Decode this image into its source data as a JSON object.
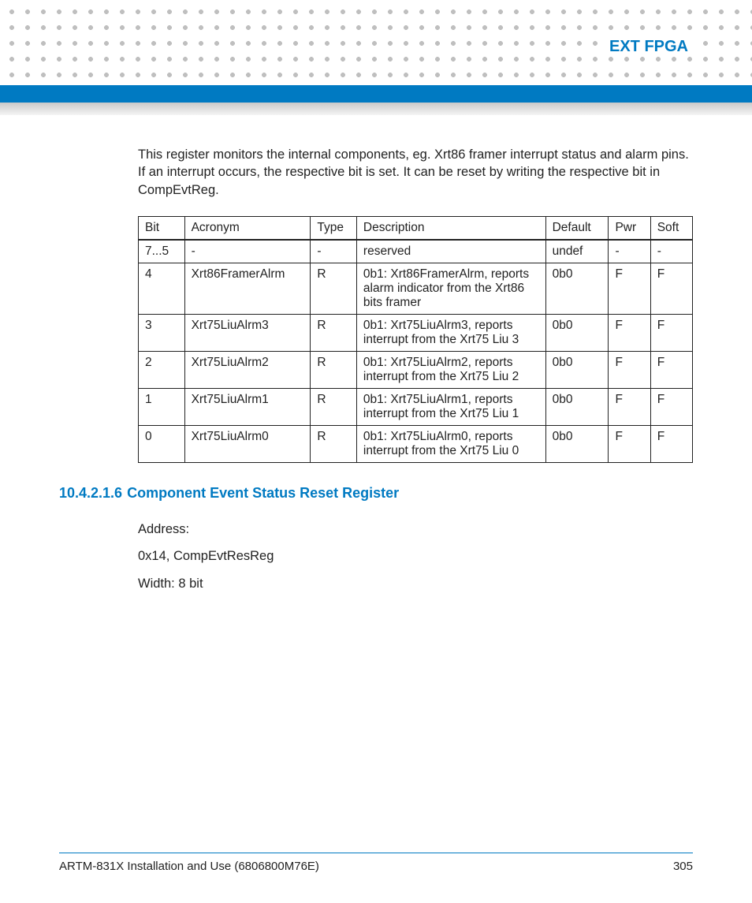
{
  "header": {
    "title": "EXT FPGA"
  },
  "intro": "This register monitors the internal components, eg. Xrt86 framer interrupt status and alarm pins. If an interrupt occurs, the respective bit is set. It can be reset by writing the respective bit in CompEvtReg.",
  "table": {
    "headers": [
      "Bit",
      "Acronym",
      "Type",
      "Description",
      "Default",
      "Pwr",
      "Soft"
    ],
    "rows": [
      {
        "bit": "7...5",
        "acr": "-",
        "type": "-",
        "desc": "reserved",
        "def": "undef",
        "pwr": "-",
        "soft": "-"
      },
      {
        "bit": "4",
        "acr": "Xrt86FramerAlrm",
        "type": "R",
        "desc": "0b1: Xrt86FramerAlrm, reports alarm indicator from the Xrt86 bits framer",
        "def": "0b0",
        "pwr": "F",
        "soft": "F"
      },
      {
        "bit": "3",
        "acr": "Xrt75LiuAlrm3",
        "type": "R",
        "desc": "0b1: Xrt75LiuAlrm3, reports interrupt from the Xrt75 Liu 3",
        "def": "0b0",
        "pwr": "F",
        "soft": "F"
      },
      {
        "bit": "2",
        "acr": "Xrt75LiuAlrm2",
        "type": "R",
        "desc": "0b1: Xrt75LiuAlrm2, reports interrupt from the Xrt75 Liu 2",
        "def": "0b0",
        "pwr": "F",
        "soft": "F"
      },
      {
        "bit": "1",
        "acr": "Xrt75LiuAlrm1",
        "type": "R",
        "desc": "0b1: Xrt75LiuAlrm1, reports interrupt from the Xrt75 Liu 1",
        "def": "0b0",
        "pwr": "F",
        "soft": "F"
      },
      {
        "bit": "0",
        "acr": "Xrt75LiuAlrm0",
        "type": "R",
        "desc": "0b1: Xrt75LiuAlrm0, reports interrupt from the Xrt75 Liu 0",
        "def": "0b0",
        "pwr": "F",
        "soft": "F"
      }
    ]
  },
  "section": {
    "number": "10.4.2.1.6",
    "title": "Component Event Status Reset Register",
    "address_label": "Address:",
    "address_value": "0x14, CompEvtResReg",
    "width": "Width: 8 bit"
  },
  "footer": {
    "left": "ARTM-831X Installation and Use (6806800M76E)",
    "right": "305"
  }
}
